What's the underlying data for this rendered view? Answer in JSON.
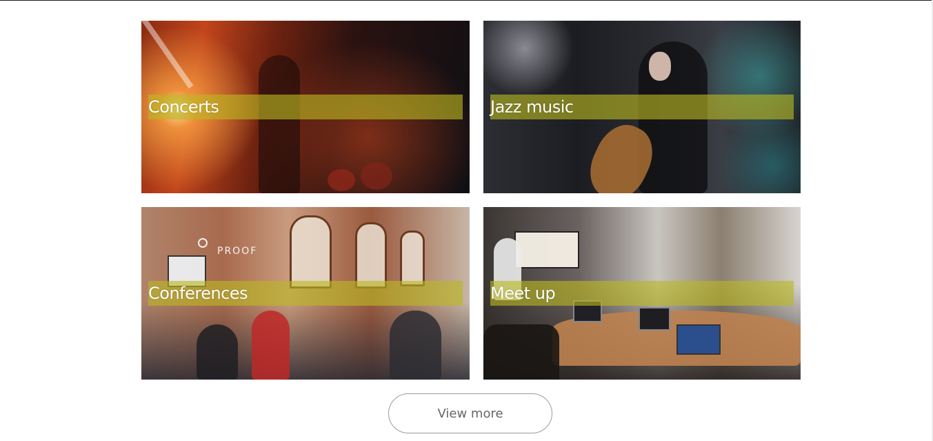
{
  "cards": [
    {
      "id": "concerts",
      "label": "Concerts",
      "image": "concert-stage-photo"
    },
    {
      "id": "jazz",
      "label": "Jazz music",
      "image": "cellist-performance-photo"
    },
    {
      "id": "conferences",
      "label": "Conferences",
      "image": "conference-room-photo"
    },
    {
      "id": "meetup",
      "label": "Meet up",
      "image": "meetup-table-laptops-photo"
    }
  ],
  "view_more": {
    "label": "View more"
  },
  "colors": {
    "label_band": "#bab822",
    "label_text": "#ffffff",
    "button_border": "#9a9a9a",
    "button_text": "#666666"
  }
}
